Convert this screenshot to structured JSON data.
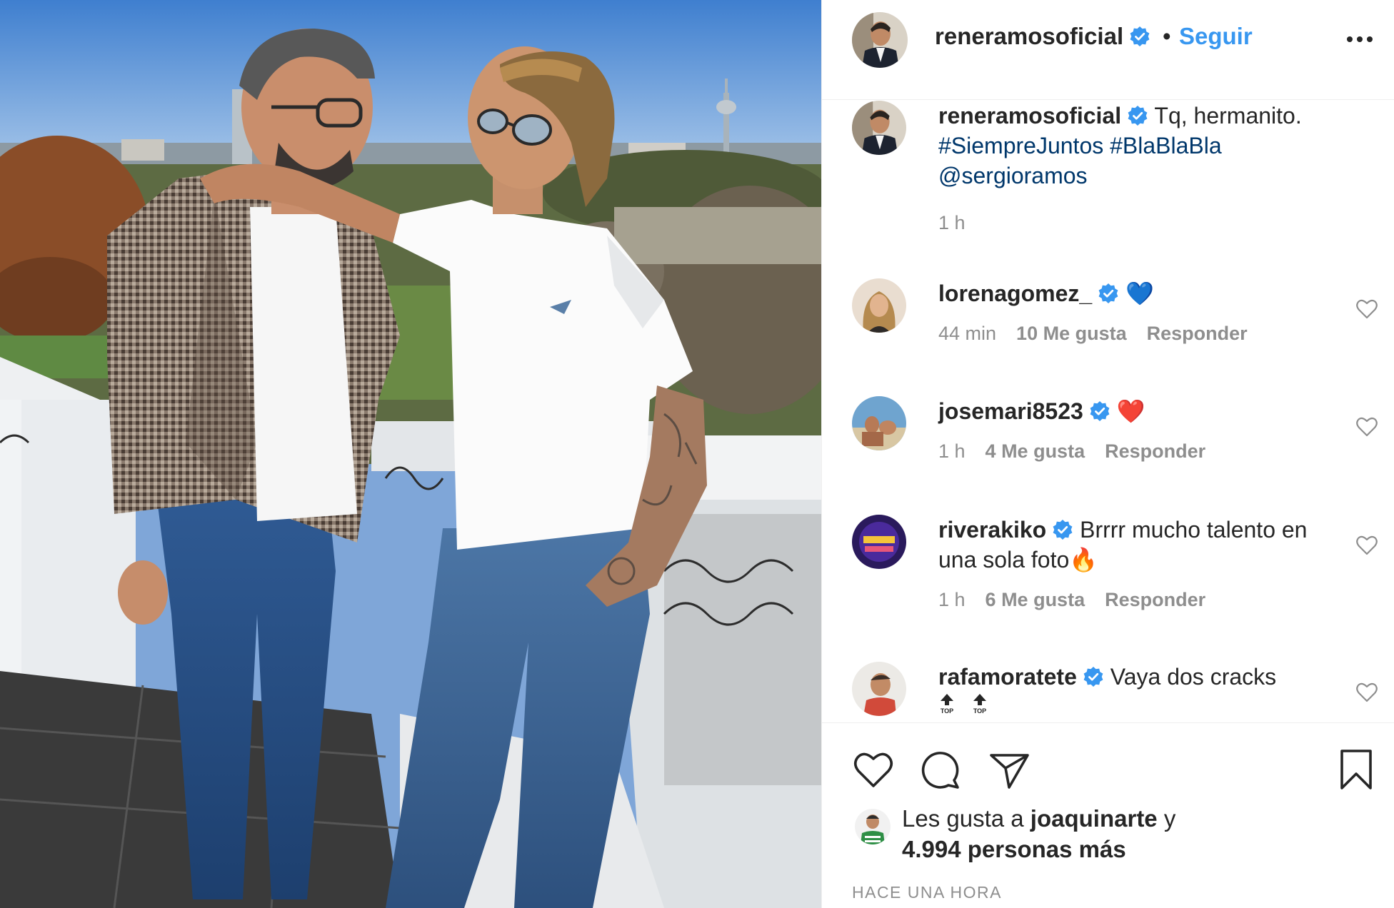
{
  "post": {
    "author": "reneramosoficial",
    "separator": "•",
    "follow_label": "Seguir",
    "more_icon": "more-options-icon"
  },
  "caption": {
    "user": "reneramosoficial",
    "text": "Tq, hermanito.",
    "hashtags": "#SiempreJuntos #BlaBlaBla",
    "mention": "@sergioramos",
    "time": "1 h"
  },
  "comments": [
    {
      "user": "lorenagomez_",
      "text": "💙",
      "time": "44 min",
      "likes": "10 Me gusta",
      "reply": "Responder"
    },
    {
      "user": "josemari8523",
      "text": "❤️",
      "time": "1 h",
      "likes": "4 Me gusta",
      "reply": "Responder"
    },
    {
      "user": "riverakiko",
      "text": "Brrrr mucho talento en una sola foto🔥",
      "time": "1 h",
      "likes": "6 Me gusta",
      "reply": "Responder"
    },
    {
      "user": "rafamoratete",
      "text": "Vaya dos cracks",
      "emoji_labels": [
        "TOP",
        "TOP"
      ]
    }
  ],
  "likes": {
    "prefix": "Les gusta a",
    "user": "joaquinarte",
    "suffix": "y",
    "others": "4.994 personas más"
  },
  "timestamp": "Hace una hora",
  "colors": {
    "link": "#3897f0",
    "hashtag": "#00376b",
    "verified": "#3897f0",
    "muted": "#8e8e8e",
    "text": "#262626"
  }
}
